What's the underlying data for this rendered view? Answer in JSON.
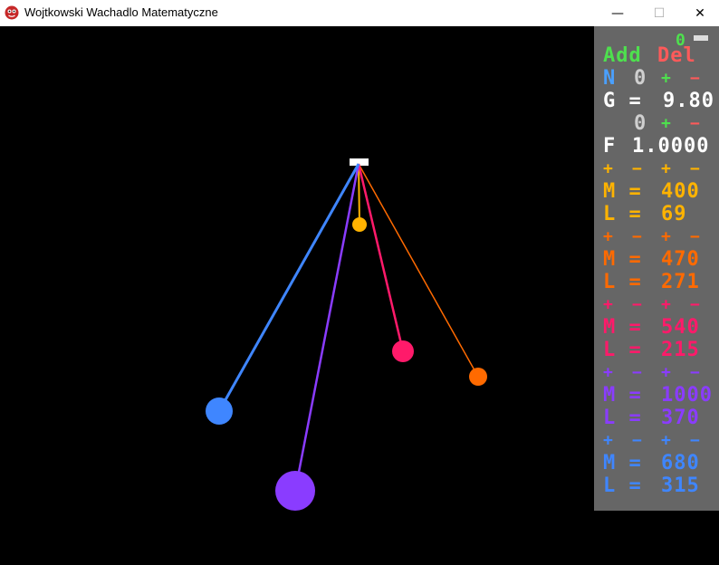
{
  "window": {
    "title": "Wojtkowski Wachadlo Matematyczne",
    "minimize": "—",
    "maximize": "☐",
    "close": "✕"
  },
  "panel": {
    "counter": "0",
    "add_label": "Add",
    "del_label": "Del",
    "n_label": "N",
    "n_value": "0",
    "plus": "+",
    "minus": "−",
    "g_label": "G =",
    "g_value": "9.80",
    "g_step": "0",
    "f_label": "F",
    "f_value": "1.0000",
    "pendulums": [
      {
        "m": "400",
        "l": "69",
        "color": "#ffb300"
      },
      {
        "m": "470",
        "l": "271",
        "color": "#ff6a00"
      },
      {
        "m": "540",
        "l": "215",
        "color": "#ff1a6a"
      },
      {
        "m": "1000",
        "l": "370",
        "color": "#8a3cff"
      },
      {
        "m": "680",
        "l": "315",
        "color": "#3f86ff"
      }
    ],
    "m_label": "M =",
    "l_label": "L ="
  }
}
